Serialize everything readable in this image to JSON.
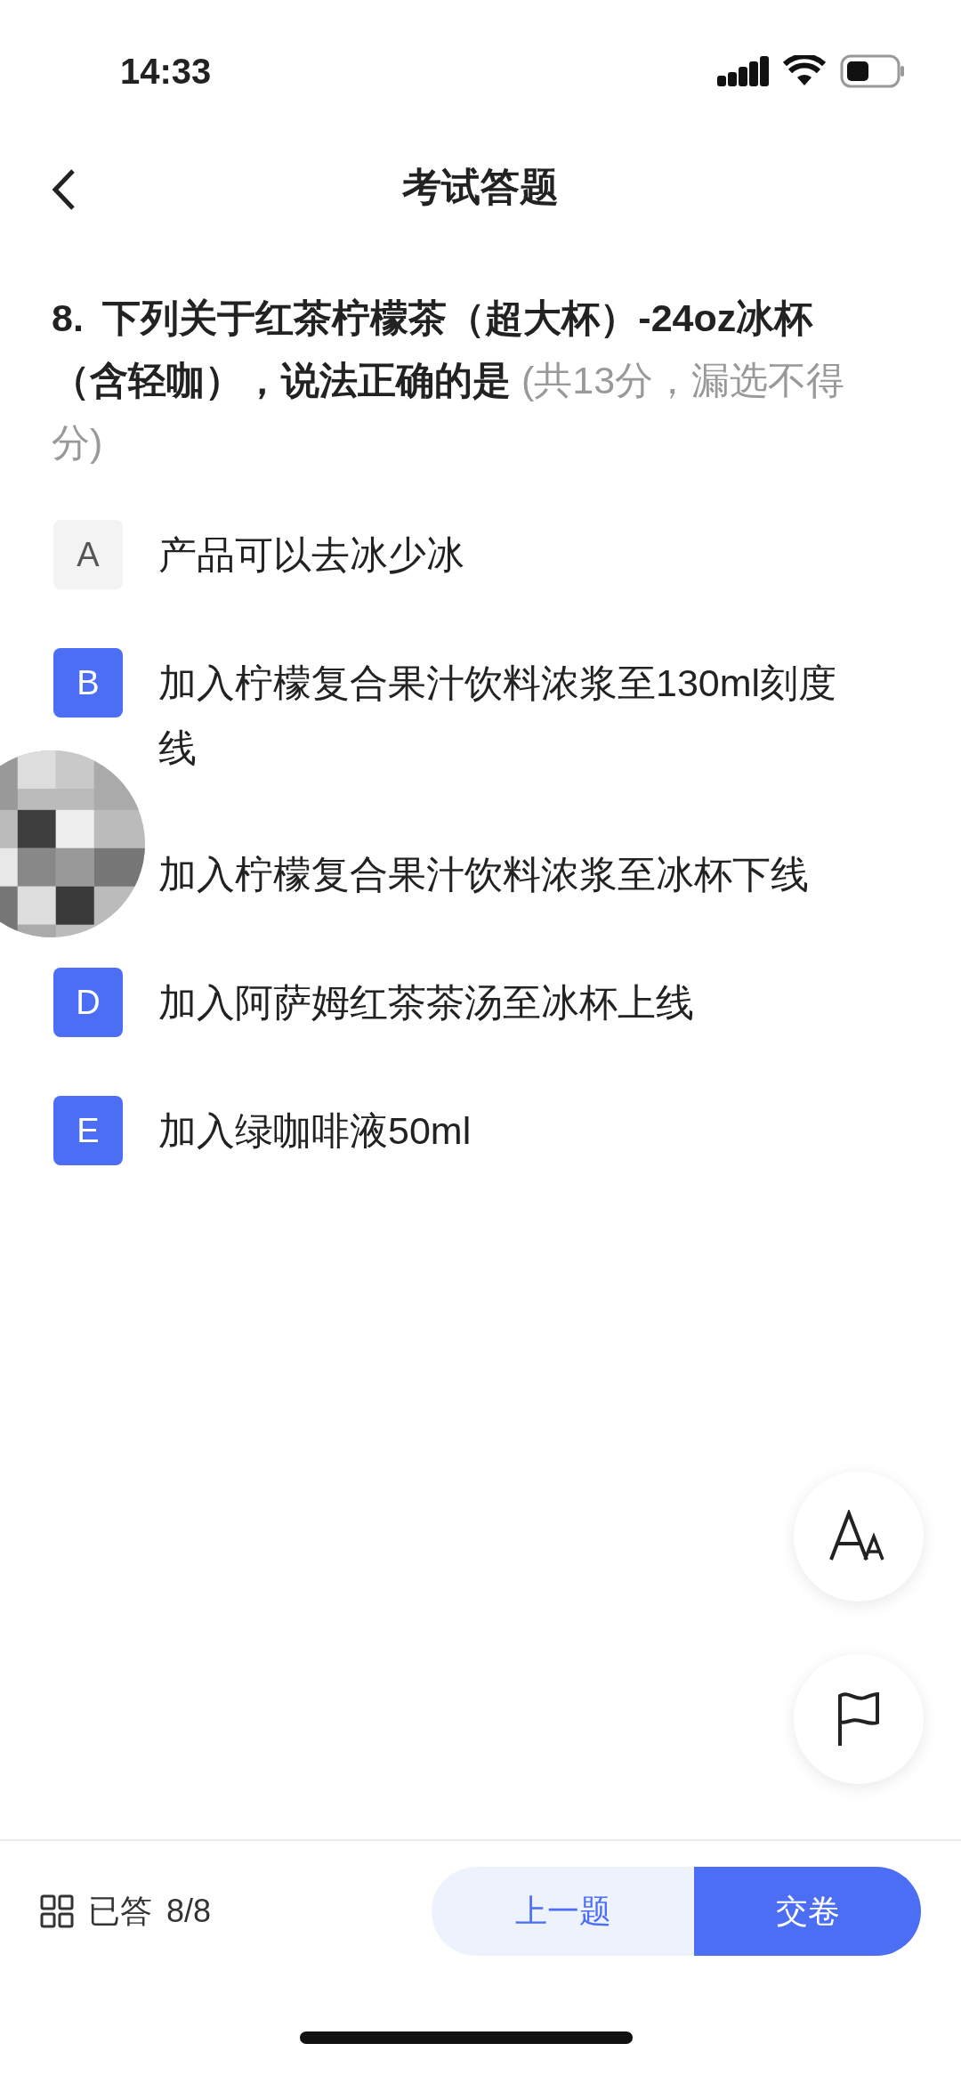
{
  "status_bar": {
    "time": "14:33"
  },
  "header": {
    "title": "考试答题"
  },
  "question": {
    "number": "8.",
    "text": "下列关于红茶柠檬茶（超大杯）-24oz冰杯（含轻咖），说法正确的是",
    "note": "(共13分，漏选不得分)"
  },
  "options": [
    {
      "letter": "A",
      "text": "产品可以去冰少冰",
      "selected": false
    },
    {
      "letter": "B",
      "text": "加入柠檬复合果汁饮料浓浆至130ml刻度线",
      "selected": true
    },
    {
      "text": "加入柠檬复合果汁饮料浓浆至冰杯下线"
    },
    {
      "letter": "D",
      "text": "加入阿萨姆红茶茶汤至冰杯上线",
      "selected": true
    },
    {
      "letter": "E",
      "text": "加入绿咖啡液50ml",
      "selected": true
    }
  ],
  "footer": {
    "answered_label": "已答",
    "answered_count": "8/8",
    "buttons": [
      {
        "kind": "secondary",
        "label": "上一题"
      },
      {
        "kind": "primary",
        "label": "交卷"
      }
    ]
  }
}
